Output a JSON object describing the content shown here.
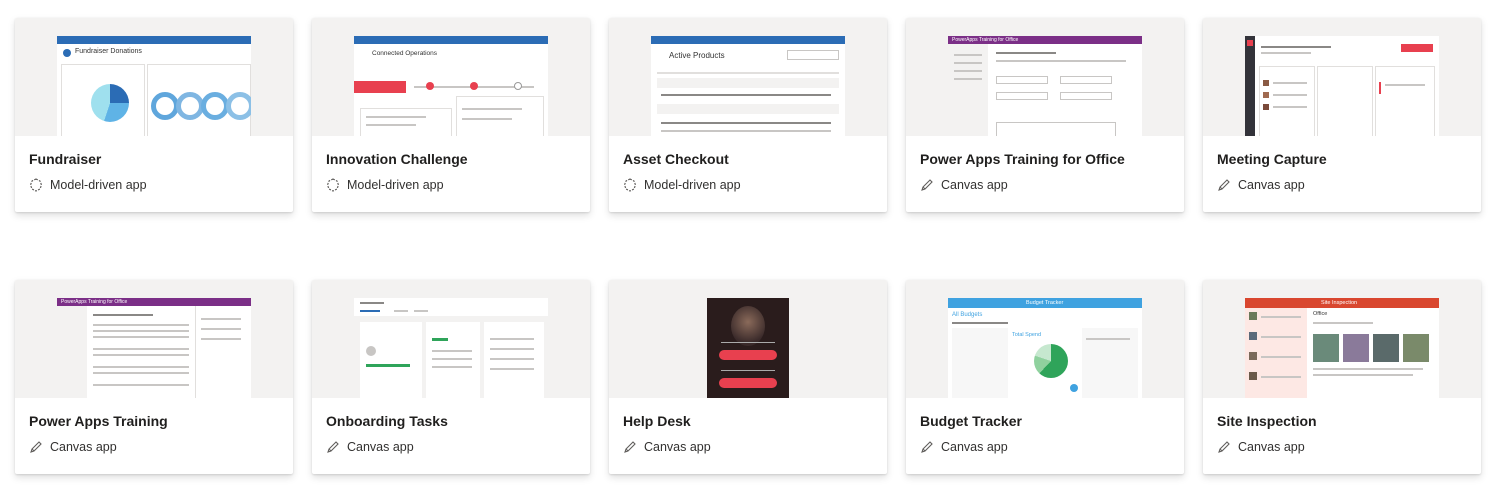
{
  "apps": [
    {
      "title": "Fundraiser",
      "type": "Model-driven app",
      "type_icon": "model-driven-icon",
      "thumb": {
        "header": "Fundraiser Donations"
      }
    },
    {
      "title": "Innovation Challenge",
      "type": "Model-driven app",
      "type_icon": "model-driven-icon",
      "thumb": {
        "header": "Connected Operations"
      }
    },
    {
      "title": "Asset Checkout",
      "type": "Model-driven app",
      "type_icon": "model-driven-icon",
      "thumb": {
        "header": "Active Products"
      }
    },
    {
      "title": "Power Apps Training for Office",
      "type": "Canvas app",
      "type_icon": "pencil-icon",
      "thumb": {
        "header": "PowerApps Training for Office"
      }
    },
    {
      "title": "Meeting Capture",
      "type": "Canvas app",
      "type_icon": "pencil-icon",
      "thumb": {
        "header": ""
      }
    },
    {
      "title": "Power Apps Training",
      "type": "Canvas app",
      "type_icon": "pencil-icon",
      "thumb": {
        "header": "PowerApps Training for Office"
      }
    },
    {
      "title": "Onboarding Tasks",
      "type": "Canvas app",
      "type_icon": "pencil-icon",
      "thumb": {
        "header": ""
      }
    },
    {
      "title": "Help Desk",
      "type": "Canvas app",
      "type_icon": "pencil-icon",
      "thumb": {
        "header": ""
      }
    },
    {
      "title": "Budget Tracker",
      "type": "Canvas app",
      "type_icon": "pencil-icon",
      "thumb": {
        "header": "Budget Tracker",
        "sub": "All Budgets",
        "total": "Total Spend"
      }
    },
    {
      "title": "Site Inspection",
      "type": "Canvas app",
      "type_icon": "pencil-icon",
      "thumb": {
        "header": "Site Inspection",
        "item": "Office"
      }
    }
  ],
  "colors": {
    "modelBlue": "#2b6cb5",
    "purple": "#7b2f87",
    "red": "#e8404f",
    "budgetBlue": "#3fa2e0",
    "siteRed": "#d9472f",
    "green": "#2fa45a"
  }
}
